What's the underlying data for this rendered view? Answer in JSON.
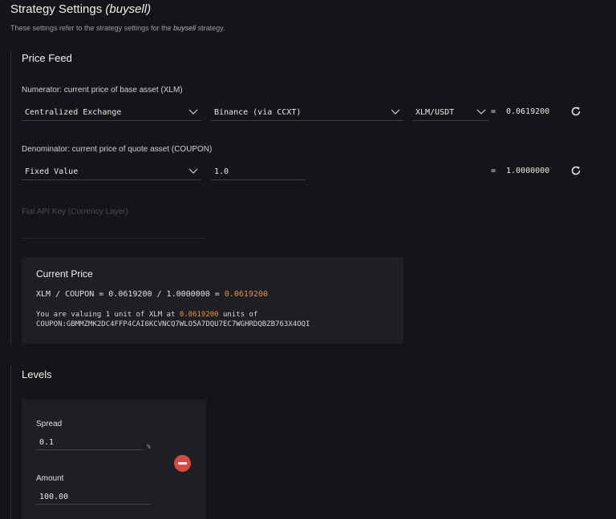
{
  "header": {
    "title": "Strategy Settings",
    "strategy_name": "(buysell)",
    "subtitle_prefix": "These settings refer to the strategy settings for the",
    "subtitle_strategy": "buysell",
    "subtitle_suffix": "strategy."
  },
  "price_feed": {
    "title": "Price Feed",
    "numerator": {
      "label": "Numerator: current price of base asset (XLM)",
      "source_type": "Centralized Exchange",
      "exchange": "Binance (via CCXT)",
      "pair": "XLM/USDT",
      "equals": "=",
      "value": "0.0619200"
    },
    "denominator": {
      "label": "Denominator: current price of quote asset (COUPON)",
      "source_type": "Fixed Value",
      "fixed_value": "1.0",
      "equals": "=",
      "value": "1.0000000"
    },
    "fiat_api_key": {
      "label": "Fiat API Key (Currency Layer)",
      "value": ""
    },
    "current_price": {
      "heading": "Current Price",
      "formula_prefix": "XLM / COUPON = 0.0619200 / 1.0000000 =",
      "result": "0.0619200",
      "desc_line1_prefix": "You are valuing 1 unit of XLM at",
      "desc_line1_value": "0.0619200",
      "desc_line1_suffix": "units of",
      "desc_line2": "COUPON:GBMMZMK2DC4FFP4CAI6KCVNCQ7WLO5A7DQU7EC7WGHRDQBZB763X4OQI"
    }
  },
  "levels": {
    "title": "Levels",
    "spread_label": "Spread",
    "spread_value": "0.1",
    "spread_unit": "%",
    "amount_label": "Amount",
    "amount_value": "100.00"
  },
  "colors": {
    "background": "#141518",
    "panel": "#1d1f23",
    "accent_orange": "#f0913e",
    "remove_red": "#d64a43"
  },
  "icons": {
    "dropdown": "chevron-down-icon",
    "refresh": "refresh-icon",
    "remove": "remove-circle-icon"
  }
}
